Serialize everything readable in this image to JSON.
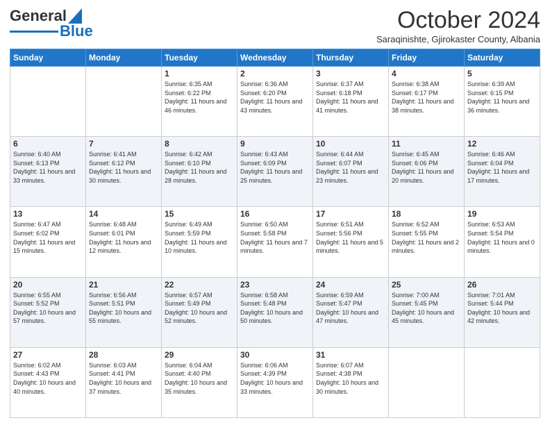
{
  "logo": {
    "line1": "General",
    "line2": "Blue"
  },
  "header": {
    "month": "October 2024",
    "subtitle": "Saraqinishte, Gjirokaster County, Albania"
  },
  "days": [
    "Sunday",
    "Monday",
    "Tuesday",
    "Wednesday",
    "Thursday",
    "Friday",
    "Saturday"
  ],
  "weeks": [
    [
      {
        "day": "",
        "sunrise": "",
        "sunset": "",
        "daylight": ""
      },
      {
        "day": "",
        "sunrise": "",
        "sunset": "",
        "daylight": ""
      },
      {
        "day": "1",
        "sunrise": "Sunrise: 6:35 AM",
        "sunset": "Sunset: 6:22 PM",
        "daylight": "Daylight: 11 hours and 46 minutes."
      },
      {
        "day": "2",
        "sunrise": "Sunrise: 6:36 AM",
        "sunset": "Sunset: 6:20 PM",
        "daylight": "Daylight: 11 hours and 43 minutes."
      },
      {
        "day": "3",
        "sunrise": "Sunrise: 6:37 AM",
        "sunset": "Sunset: 6:18 PM",
        "daylight": "Daylight: 11 hours and 41 minutes."
      },
      {
        "day": "4",
        "sunrise": "Sunrise: 6:38 AM",
        "sunset": "Sunset: 6:17 PM",
        "daylight": "Daylight: 11 hours and 38 minutes."
      },
      {
        "day": "5",
        "sunrise": "Sunrise: 6:39 AM",
        "sunset": "Sunset: 6:15 PM",
        "daylight": "Daylight: 11 hours and 36 minutes."
      }
    ],
    [
      {
        "day": "6",
        "sunrise": "Sunrise: 6:40 AM",
        "sunset": "Sunset: 6:13 PM",
        "daylight": "Daylight: 11 hours and 33 minutes."
      },
      {
        "day": "7",
        "sunrise": "Sunrise: 6:41 AM",
        "sunset": "Sunset: 6:12 PM",
        "daylight": "Daylight: 11 hours and 30 minutes."
      },
      {
        "day": "8",
        "sunrise": "Sunrise: 6:42 AM",
        "sunset": "Sunset: 6:10 PM",
        "daylight": "Daylight: 11 hours and 28 minutes."
      },
      {
        "day": "9",
        "sunrise": "Sunrise: 6:43 AM",
        "sunset": "Sunset: 6:09 PM",
        "daylight": "Daylight: 11 hours and 25 minutes."
      },
      {
        "day": "10",
        "sunrise": "Sunrise: 6:44 AM",
        "sunset": "Sunset: 6:07 PM",
        "daylight": "Daylight: 11 hours and 23 minutes."
      },
      {
        "day": "11",
        "sunrise": "Sunrise: 6:45 AM",
        "sunset": "Sunset: 6:06 PM",
        "daylight": "Daylight: 11 hours and 20 minutes."
      },
      {
        "day": "12",
        "sunrise": "Sunrise: 6:46 AM",
        "sunset": "Sunset: 6:04 PM",
        "daylight": "Daylight: 11 hours and 17 minutes."
      }
    ],
    [
      {
        "day": "13",
        "sunrise": "Sunrise: 6:47 AM",
        "sunset": "Sunset: 6:02 PM",
        "daylight": "Daylight: 11 hours and 15 minutes."
      },
      {
        "day": "14",
        "sunrise": "Sunrise: 6:48 AM",
        "sunset": "Sunset: 6:01 PM",
        "daylight": "Daylight: 11 hours and 12 minutes."
      },
      {
        "day": "15",
        "sunrise": "Sunrise: 6:49 AM",
        "sunset": "Sunset: 5:59 PM",
        "daylight": "Daylight: 11 hours and 10 minutes."
      },
      {
        "day": "16",
        "sunrise": "Sunrise: 6:50 AM",
        "sunset": "Sunset: 5:58 PM",
        "daylight": "Daylight: 11 hours and 7 minutes."
      },
      {
        "day": "17",
        "sunrise": "Sunrise: 6:51 AM",
        "sunset": "Sunset: 5:56 PM",
        "daylight": "Daylight: 11 hours and 5 minutes."
      },
      {
        "day": "18",
        "sunrise": "Sunrise: 6:52 AM",
        "sunset": "Sunset: 5:55 PM",
        "daylight": "Daylight: 11 hours and 2 minutes."
      },
      {
        "day": "19",
        "sunrise": "Sunrise: 6:53 AM",
        "sunset": "Sunset: 5:54 PM",
        "daylight": "Daylight: 11 hours and 0 minutes."
      }
    ],
    [
      {
        "day": "20",
        "sunrise": "Sunrise: 6:55 AM",
        "sunset": "Sunset: 5:52 PM",
        "daylight": "Daylight: 10 hours and 57 minutes."
      },
      {
        "day": "21",
        "sunrise": "Sunrise: 6:56 AM",
        "sunset": "Sunset: 5:51 PM",
        "daylight": "Daylight: 10 hours and 55 minutes."
      },
      {
        "day": "22",
        "sunrise": "Sunrise: 6:57 AM",
        "sunset": "Sunset: 5:49 PM",
        "daylight": "Daylight: 10 hours and 52 minutes."
      },
      {
        "day": "23",
        "sunrise": "Sunrise: 6:58 AM",
        "sunset": "Sunset: 5:48 PM",
        "daylight": "Daylight: 10 hours and 50 minutes."
      },
      {
        "day": "24",
        "sunrise": "Sunrise: 6:59 AM",
        "sunset": "Sunset: 5:47 PM",
        "daylight": "Daylight: 10 hours and 47 minutes."
      },
      {
        "day": "25",
        "sunrise": "Sunrise: 7:00 AM",
        "sunset": "Sunset: 5:45 PM",
        "daylight": "Daylight: 10 hours and 45 minutes."
      },
      {
        "day": "26",
        "sunrise": "Sunrise: 7:01 AM",
        "sunset": "Sunset: 5:44 PM",
        "daylight": "Daylight: 10 hours and 42 minutes."
      }
    ],
    [
      {
        "day": "27",
        "sunrise": "Sunrise: 6:02 AM",
        "sunset": "Sunset: 4:43 PM",
        "daylight": "Daylight: 10 hours and 40 minutes."
      },
      {
        "day": "28",
        "sunrise": "Sunrise: 6:03 AM",
        "sunset": "Sunset: 4:41 PM",
        "daylight": "Daylight: 10 hours and 37 minutes."
      },
      {
        "day": "29",
        "sunrise": "Sunrise: 6:04 AM",
        "sunset": "Sunset: 4:40 PM",
        "daylight": "Daylight: 10 hours and 35 minutes."
      },
      {
        "day": "30",
        "sunrise": "Sunrise: 6:06 AM",
        "sunset": "Sunset: 4:39 PM",
        "daylight": "Daylight: 10 hours and 33 minutes."
      },
      {
        "day": "31",
        "sunrise": "Sunrise: 6:07 AM",
        "sunset": "Sunset: 4:38 PM",
        "daylight": "Daylight: 10 hours and 30 minutes."
      },
      {
        "day": "",
        "sunrise": "",
        "sunset": "",
        "daylight": ""
      },
      {
        "day": "",
        "sunrise": "",
        "sunset": "",
        "daylight": ""
      }
    ]
  ]
}
